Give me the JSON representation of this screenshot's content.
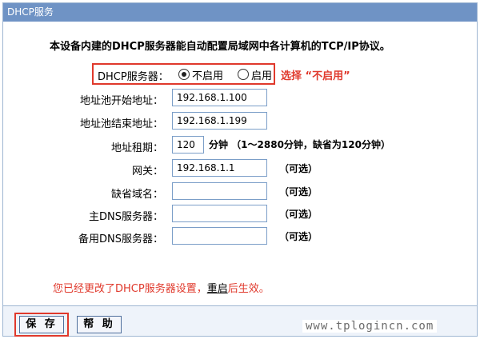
{
  "title": "DHCP服务",
  "intro": "本设备内建的DHCP服务器能自动配置局域网中各计算机的TCP/IP协议。",
  "dhcp_server": {
    "label": "DHCP服务器：",
    "options": [
      "不启用",
      "启用"
    ],
    "selected": "不启用",
    "hint": "选择 “不启用”"
  },
  "fields": {
    "pool_start": {
      "label": "地址池开始地址：",
      "value": "192.168.1.100"
    },
    "pool_end": {
      "label": "地址池结束地址：",
      "value": "192.168.1.199"
    },
    "lease": {
      "label": "地址租期：",
      "value": "120",
      "note": "分钟 （1～2880分钟，缺省为120分钟）"
    },
    "gateway": {
      "label": "网关：",
      "value": "192.168.1.1",
      "note": "（可选）"
    },
    "domain": {
      "label": "缺省域名：",
      "value": "",
      "note": "（可选）"
    },
    "primary_dns": {
      "label": "主DNS服务器：",
      "value": "",
      "note": "（可选）"
    },
    "secondary_dns": {
      "label": "备用DNS服务器：",
      "value": "",
      "note": "（可选）"
    }
  },
  "status": {
    "prefix": "您已经更改了DHCP服务器设置，",
    "link": "重启",
    "suffix": "后生效。"
  },
  "buttons": {
    "save": "保 存",
    "help": "帮 助"
  },
  "watermark": "www.tplogincn.com",
  "colors": {
    "title_bar": "#6f93c5",
    "highlight": "#e0392c",
    "input_border": "#7b9ec8"
  }
}
